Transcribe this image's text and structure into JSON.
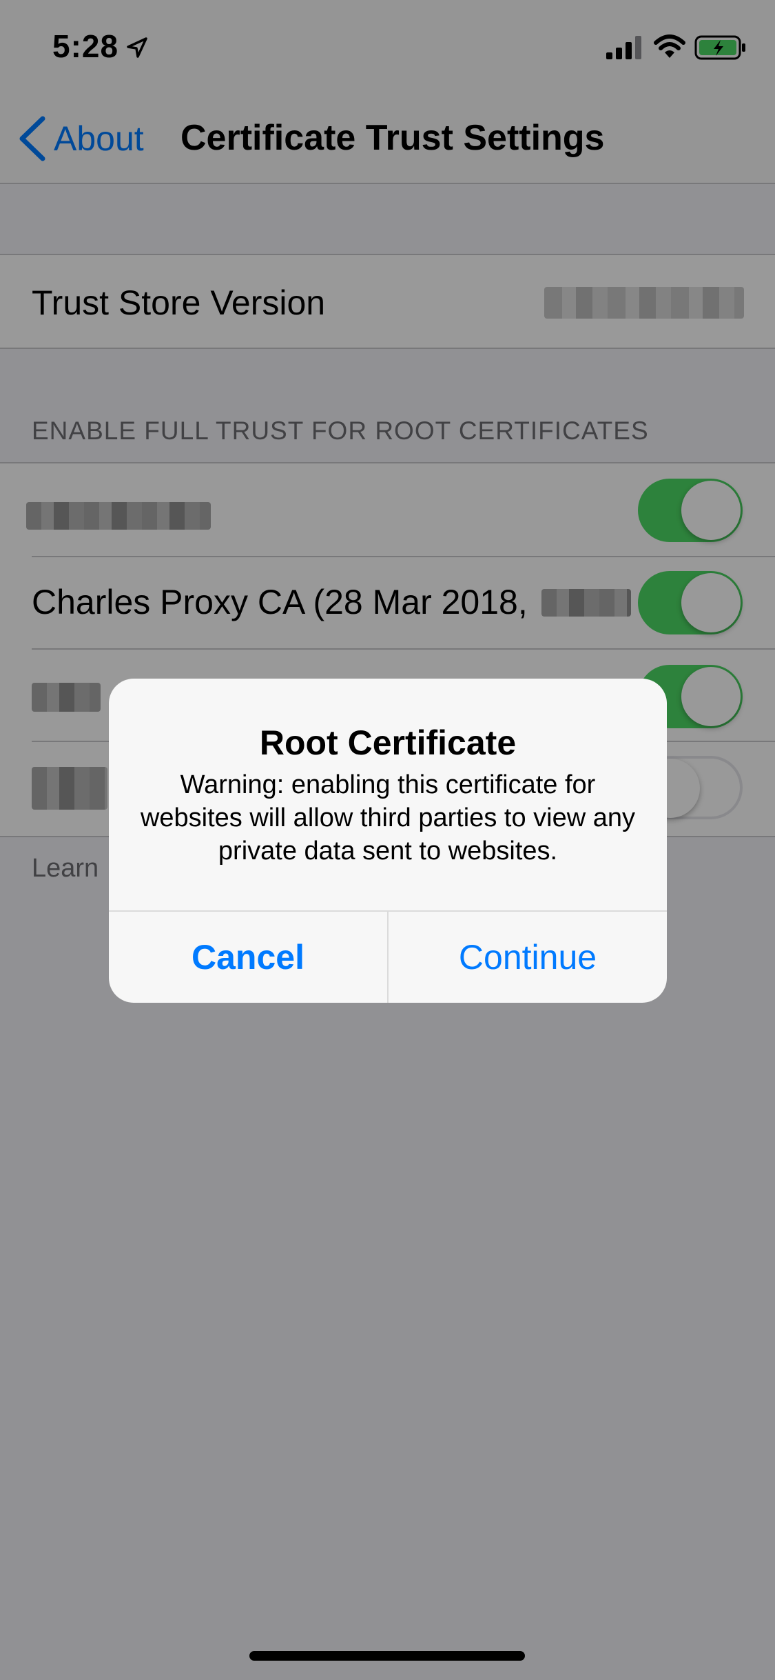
{
  "status_bar": {
    "time": "5:28",
    "icons": [
      "location-arrow-icon",
      "cellular-signal-icon",
      "wifi-icon",
      "battery-charging-icon"
    ],
    "battery_color": "#4cd964"
  },
  "nav": {
    "back_label": "About",
    "title": "Certificate Trust Settings"
  },
  "trust_store": {
    "label": "Trust Store Version"
  },
  "section": {
    "header": "ENABLE FULL TRUST FOR ROOT CERTIFICATES"
  },
  "certificates": [
    {
      "label": "",
      "enabled": true
    },
    {
      "label": "Charles Proxy CA (28 Mar 2018,",
      "enabled": true
    },
    {
      "label": "",
      "enabled": true
    },
    {
      "label": "",
      "enabled": false
    }
  ],
  "footer": {
    "text": "Learn"
  },
  "alert": {
    "title": "Root Certificate",
    "message": "Warning: enabling this certificate for websites will allow third parties to view any private data sent to websites.",
    "cancel_label": "Cancel",
    "continue_label": "Continue"
  },
  "colors": {
    "accent": "#007aff",
    "toggle_on": "#4cd964"
  }
}
